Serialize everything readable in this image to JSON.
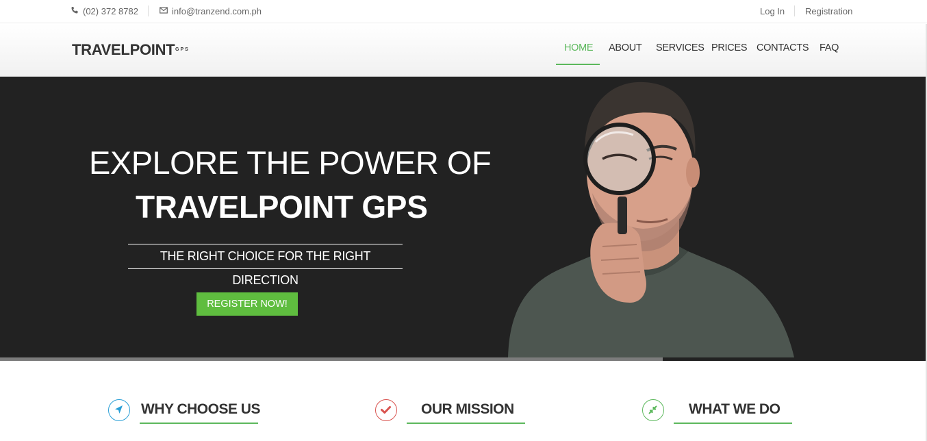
{
  "topbar": {
    "phone": "(02) 372 8782",
    "email": "info@tranzend.com.ph",
    "login_label": "Log In",
    "registration_label": "Registration"
  },
  "header": {
    "logo": "TRAVELPOINT",
    "logo_sub": "GPS",
    "nav": [
      {
        "label": "HOME",
        "active": true
      },
      {
        "label": "ABOUT",
        "active": false
      },
      {
        "label": "SERVICES",
        "active": false
      },
      {
        "label": "PRICES",
        "active": false
      },
      {
        "label": "CONTACTS",
        "active": false
      },
      {
        "label": "FAQ",
        "active": false
      }
    ]
  },
  "hero": {
    "headline_line1": "EXPLORE THE POWER OF",
    "headline_line2": "TRAVELPOINT GPS",
    "tagline": "THE RIGHT CHOICE FOR THE RIGHT DIRECTION",
    "cta_label": "REGISTER NOW!"
  },
  "features": [
    {
      "title": "WHY CHOOSE US",
      "icon": "navigation-arrow-icon",
      "icon_color": "#2a9fd6"
    },
    {
      "title": "OUR MISSION",
      "icon": "checkmark-icon",
      "icon_color": "#d9534f"
    },
    {
      "title": "WHAT WE DO",
      "icon": "compress-arrows-icon",
      "icon_color": "#5cb85c"
    }
  ],
  "colors": {
    "accent": "#5cb85c",
    "hero_bg": "#222222",
    "cta_bg": "#5fbd3f"
  }
}
